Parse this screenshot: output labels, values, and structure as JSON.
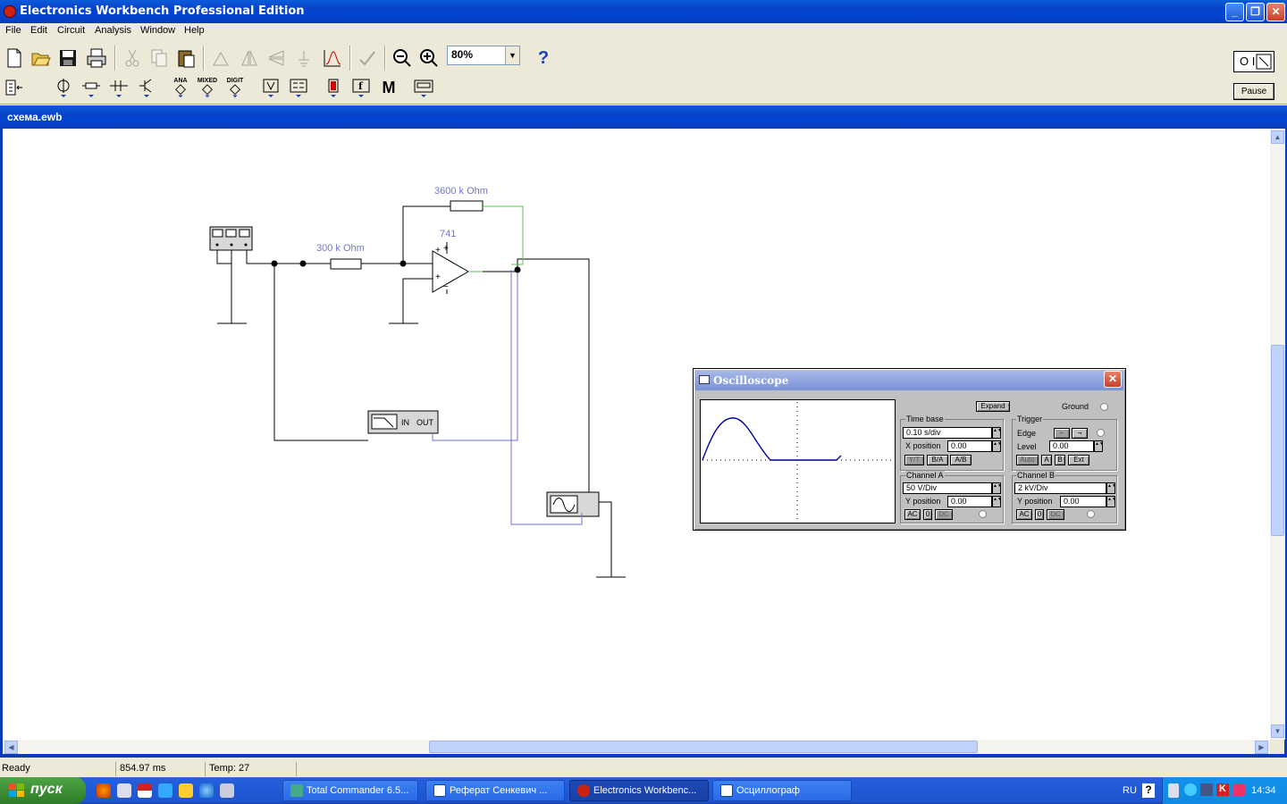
{
  "app": {
    "title": "Electronics Workbench Professional Edition",
    "caption_buttons": [
      "_",
      "❐",
      "✕"
    ]
  },
  "menu": [
    "File",
    "Edit",
    "Circuit",
    "Analysis",
    "Window",
    "Help"
  ],
  "toolbar": {
    "zoom_value": "80%",
    "help_label": "?",
    "power_label": "O I",
    "pause_label": "Pause",
    "parts_labels": {
      "ana": "ANA",
      "mixed": "MIXED",
      "digit": "DIGIT",
      "misc": "M"
    }
  },
  "document": {
    "title": "схема.ewb",
    "components": {
      "feedback_resistor": "3600 k Ohm",
      "input_resistor": "300 k Ohm",
      "opamp": "741",
      "opamp_plus": "+",
      "opamp_minus": "+",
      "opamp_vplus": "+",
      "opamp_vminus": "−",
      "bode_in": "IN",
      "bode_out": "OUT"
    }
  },
  "oscilloscope": {
    "title": "Oscilloscope",
    "expand_label": "Expand",
    "ground_label": "Ground",
    "time_base": {
      "label": "Time base",
      "value": "0.10 s/div",
      "x_position_label": "X position",
      "x_position": "0.00",
      "modes": [
        "Y/T",
        "B/A",
        "A/B"
      ]
    },
    "trigger": {
      "label": "Trigger",
      "edge_label": "Edge",
      "level_label": "Level",
      "level": "0.00",
      "sources": [
        "Auto",
        "A",
        "B",
        "Ext"
      ]
    },
    "channel_a": {
      "label": "Channel A",
      "value": "50  V/Div",
      "y_position_label": "Y position",
      "y_position": "0.00",
      "coupling": [
        "AC",
        "0",
        "DC"
      ]
    },
    "channel_b": {
      "label": "Channel B",
      "value": "2 kV/Div",
      "y_position_label": "Y position",
      "y_position": "0.00",
      "coupling": [
        "AC",
        "0",
        "DC"
      ]
    },
    "colors": {
      "trace": "#0000a8",
      "window_bg": "#c0c0c0"
    }
  },
  "statusbar": {
    "state": "Ready",
    "time": "854.97 ms",
    "temp": "Temp:  27"
  },
  "taskbar": {
    "start_label": "пуск",
    "tasks": [
      "Total Commander 6.5...",
      "Реферат Сенкевич ...",
      "Electronics Workbenc...",
      "Осциллограф"
    ],
    "lang": "RU",
    "help_glyph": "?",
    "clock": "14:34"
  }
}
